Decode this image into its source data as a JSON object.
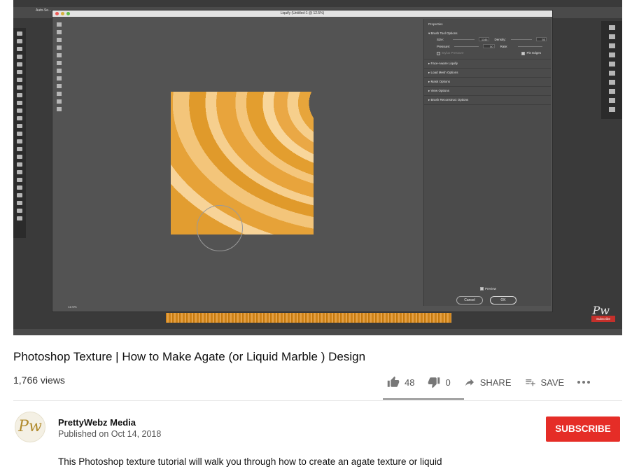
{
  "player": {
    "ps_toolbar_text": "Auto-Se...",
    "liquify_title": "Liquify (Untitled-1 @ 12.5%)",
    "zoom": "12.5%",
    "status": "Doc: 37.9M/37.9M",
    "properties": {
      "header": "Properties",
      "brush_tool_options": "Brush Tool Options",
      "size_label": "Size:",
      "size_value": "1146",
      "density_label": "Density:",
      "density_value": "50",
      "pressure_label": "Pressure:",
      "pressure_value": "50",
      "rate_label": "Rate:",
      "stylus_pressure": "Stylus Pressure",
      "pin_edges": "Pin Edges",
      "sections": [
        "Face-Aware Liquify",
        "Load Mesh Options",
        "Mask Options",
        "View Options",
        "Brush Reconstruct Options"
      ],
      "preview": "Preview",
      "cancel": "Cancel",
      "ok": "OK"
    },
    "watermark_badge": "Subscribe"
  },
  "video": {
    "title": "Photoshop Texture | How to Make Agate (or Liquid Marble ) Design",
    "views": "1,766 views",
    "likes": "48",
    "dislikes": "0",
    "share_label": "SHARE",
    "save_label": "SAVE"
  },
  "channel": {
    "name": "PrettyWebz Media",
    "published": "Published on Oct 14, 2018",
    "subscribe_label": "SUBSCRIBE",
    "avatar_text": "Pw"
  },
  "description": "This Photoshop texture tutorial will walk you through how to create an agate texture or liquid",
  "colors": {
    "subscribe": "#e52d27",
    "accent_orange": "#e9a43a"
  }
}
